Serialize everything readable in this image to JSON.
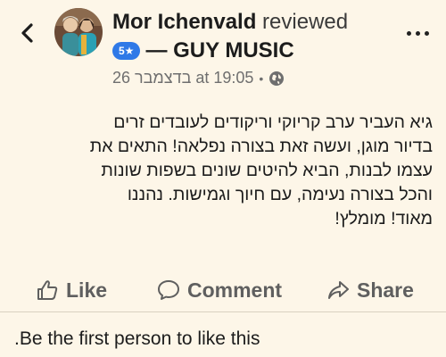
{
  "header": {
    "back_icon": "chevron-left-icon",
    "reviewer_name": "Mor Ichenvald",
    "action_text": "reviewed",
    "rating_badge": "5★",
    "page_name": "— GUY MUSIC",
    "more_icon": "more-dots-icon"
  },
  "meta": {
    "timestamp": "בדצמבר 26 at 19:05",
    "separator": "•",
    "privacy_icon": "globe-icon"
  },
  "post": {
    "lines": [
      "גיא העביר ערב קריוקי וריקודים לעובדים זרים",
      "בדיור מוגן, ועשה זאת בצורה נפלאה! התאים את",
      "עצמו לבנות, הביא להיטים שונים בשפות שונות",
      "והכל בצורה נעימה, עם חיוך וגמישות. נהננו",
      "מאוד! מומלץ!"
    ]
  },
  "actions": {
    "like_label": "Like",
    "comment_label": "Comment",
    "share_label": "Share"
  },
  "likes_summary": ".Be the first person to like this",
  "colors": {
    "background": "#fdf6e8",
    "badge": "#2f79e7",
    "action_text": "#5f5f5f",
    "meta_text": "#6f6f6f"
  }
}
